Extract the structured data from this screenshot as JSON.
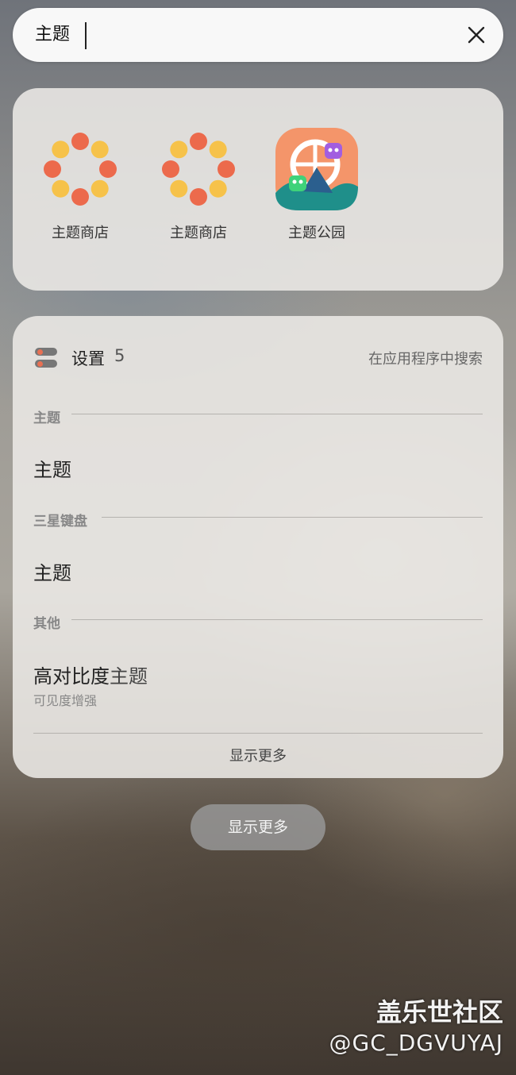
{
  "search": {
    "query": "主题"
  },
  "apps": [
    {
      "label": "主题商店",
      "icon": "theme-store-flower-icon"
    },
    {
      "label": "主题商店",
      "icon": "theme-store-flower-icon"
    },
    {
      "label": "主题公园",
      "icon": "theme-park-icon"
    }
  ],
  "settings": {
    "title": "设置",
    "count": "5",
    "search_in_app": "在应用程序中搜索",
    "sections": [
      {
        "header": "主题",
        "results": [
          {
            "title": "主题"
          }
        ]
      },
      {
        "header": "三星键盘",
        "results": [
          {
            "title": "主题"
          }
        ]
      },
      {
        "header": "其他",
        "results": [
          {
            "title_prefix": "高对比度",
            "title_match": "主题",
            "subtitle": "可见度增强"
          }
        ]
      }
    ],
    "show_more": "显示更多"
  },
  "show_more_button": "显示更多",
  "watermark": {
    "line1": "盖乐世社区",
    "line2": "@GC_DGVUYAJ"
  },
  "colors": {
    "flower_orange": "#ec6a4c",
    "flower_yellow": "#f6c24a",
    "park_orange": "#f4956a",
    "park_teal": "#1f8f8a"
  }
}
